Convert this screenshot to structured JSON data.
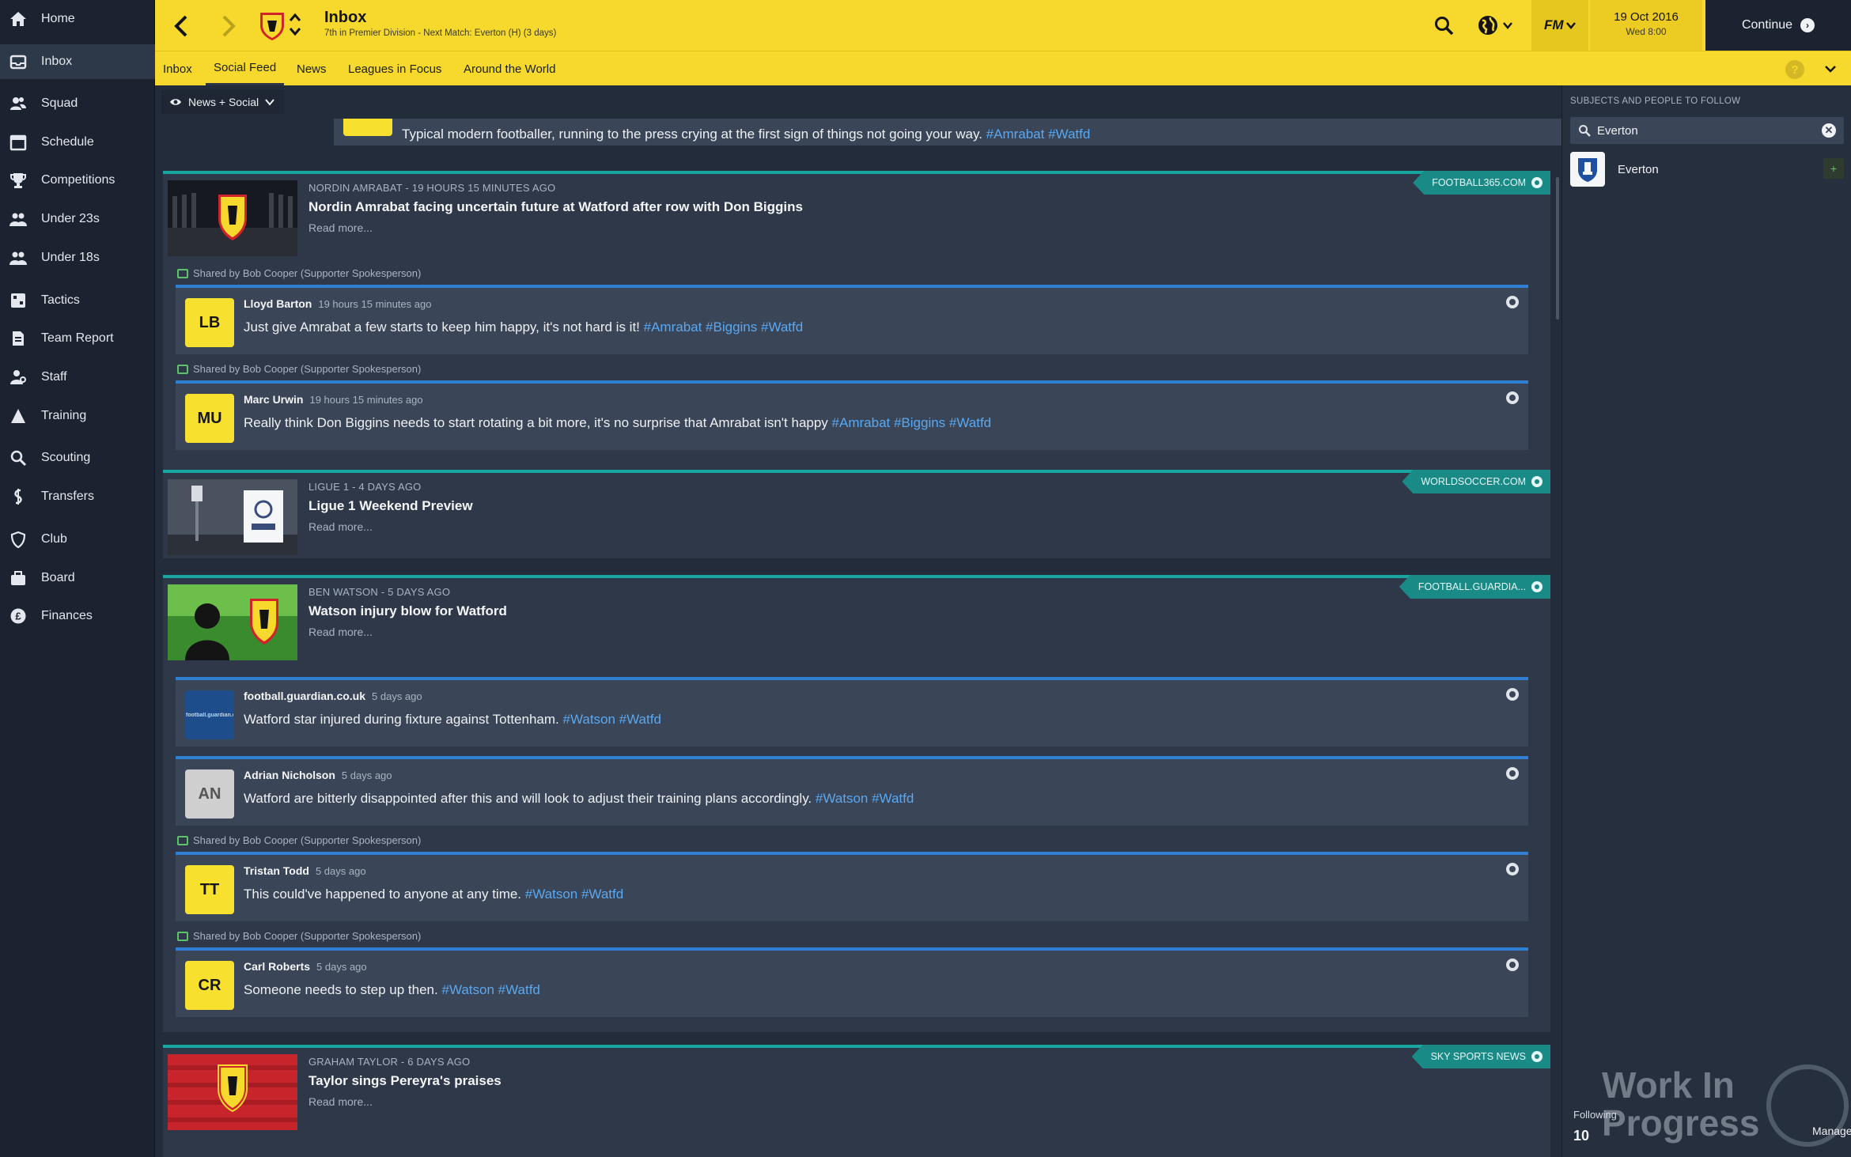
{
  "sidebar": {
    "items": [
      {
        "label": "Home",
        "icon": "home-icon"
      },
      {
        "label": "Inbox",
        "icon": "inbox-icon"
      },
      {
        "label": "Squad",
        "icon": "squad-icon"
      },
      {
        "label": "Schedule",
        "icon": "calendar-icon"
      },
      {
        "label": "Competitions",
        "icon": "trophy-icon"
      },
      {
        "label": "Under 23s",
        "icon": "group-icon"
      },
      {
        "label": "Under 18s",
        "icon": "group-icon"
      },
      {
        "label": "Tactics",
        "icon": "tactics-icon"
      },
      {
        "label": "Team Report",
        "icon": "report-icon"
      },
      {
        "label": "Staff",
        "icon": "staff-icon"
      },
      {
        "label": "Training",
        "icon": "training-icon"
      },
      {
        "label": "Scouting",
        "icon": "search-icon"
      },
      {
        "label": "Transfers",
        "icon": "transfers-icon"
      },
      {
        "label": "Club",
        "icon": "shield-icon"
      },
      {
        "label": "Board",
        "icon": "briefcase-icon"
      },
      {
        "label": "Finances",
        "icon": "pound-icon"
      }
    ],
    "active_index": 1
  },
  "header": {
    "title": "Inbox",
    "subtitle": "7th in Premier Division - Next Match: Everton (H) (3 days)",
    "fm_label": "FM",
    "date": "19 Oct 2016",
    "time": "Wed 8:00",
    "continue_label": "Continue"
  },
  "tabs": [
    "Inbox",
    "Social Feed",
    "News",
    "Leagues in Focus",
    "Around the World"
  ],
  "active_tab": 1,
  "feed": {
    "filter_label": "News + Social",
    "cut_off_text": "Typical modern footballer, running to the press crying at the first sign of things not going your way.",
    "cut_off_tags": "#Amrabat #Watfd",
    "cards": [
      {
        "meta": "NORDIN AMRABAT - 19 HOURS 15 MINUTES AGO",
        "title": "Nordin Amrabat facing uncertain future at Watford after row with Don Biggins",
        "read_more": "Read more...",
        "source": "FOOTBALL365.COM",
        "shared": [
          {
            "shared_by": "Shared by Bob Cooper (Supporter Spokesperson)",
            "initials": "LB",
            "author": "Lloyd Barton",
            "when": "19 hours 15 minutes ago",
            "text": "Just give Amrabat a few starts to keep him happy, it's not hard is it!",
            "tags": "#Amrabat #Biggins #Watfd"
          },
          {
            "shared_by": "Shared by Bob Cooper (Supporter Spokesperson)",
            "initials": "MU",
            "author": "Marc Urwin",
            "when": "19 hours 15 minutes ago",
            "text": "Really think Don Biggins needs to start rotating a bit more, it's no surprise that Amrabat isn't happy",
            "tags": "#Amrabat #Biggins #Watfd"
          }
        ]
      },
      {
        "meta": "LIGUE 1 - 4 DAYS AGO",
        "title": "Ligue 1 Weekend Preview",
        "read_more": "Read more...",
        "source": "WORLDSOCCER.COM"
      },
      {
        "meta": "BEN WATSON - 5 DAYS AGO",
        "title": "Watson injury blow for Watford",
        "read_more": "Read more...",
        "source": "FOOTBALL.GUARDIA...",
        "replies": [
          {
            "initials": "football.guardian.co.uk",
            "author": "football.guardian.co.uk",
            "when": "5 days ago",
            "text": "Watford star injured during fixture against Tottenham.",
            "tags": "#Watson #Watfd"
          },
          {
            "initials": "AN",
            "author": "Adrian Nicholson",
            "when": "5 days ago",
            "text": "Watford are bitterly disappointed after this and will look to adjust their training plans accordingly.",
            "tags": "#Watson #Watfd"
          }
        ],
        "shared": [
          {
            "shared_by": "Shared by Bob Cooper (Supporter Spokesperson)",
            "initials": "TT",
            "author": "Tristan Todd",
            "when": "5 days ago",
            "text": "This could've happened to anyone at any time.",
            "tags": "#Watson #Watfd"
          },
          {
            "shared_by": "Shared by Bob Cooper (Supporter Spokesperson)",
            "initials": "CR",
            "author": "Carl Roberts",
            "when": "5 days ago",
            "text": "Someone needs to step up then.",
            "tags": "#Watson #Watfd"
          }
        ]
      },
      {
        "meta": "GRAHAM TAYLOR - 6 DAYS AGO",
        "title": "Taylor sings Pereyra's praises",
        "read_more": "Read more...",
        "source": "SKY SPORTS NEWS"
      }
    ]
  },
  "right_panel": {
    "header": "SUBJECTS AND PEOPLE TO FOLLOW",
    "search_value": "Everton",
    "result_name": "Everton",
    "following_label": "Following",
    "following_count": "10",
    "manage_label": "Manage",
    "watermark": "Work In Progress"
  },
  "colors": {
    "accent_yellow": "#f7d92d",
    "sidebar_bg": "#1b2230",
    "feed_bg": "#232c3a",
    "card_bg": "#2e3849",
    "teal_source": "#19a5a0",
    "tweet_border": "#2f7fd3",
    "hashtag": "#5aa8f0"
  }
}
